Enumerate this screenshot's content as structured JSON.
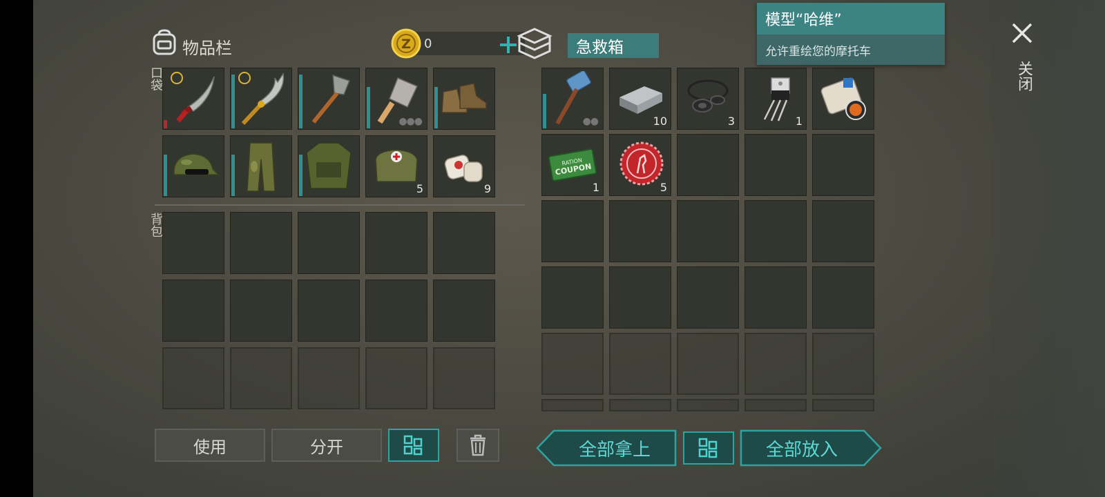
{
  "inventory": {
    "title": "物品栏",
    "coins": "0",
    "pocket_label": "口袋",
    "backpack_label": "背包",
    "pocket_items": [
      {
        "name": "machete-icon",
        "qty": ""
      },
      {
        "name": "serrated-blade-icon",
        "qty": ""
      },
      {
        "name": "shovel-icon",
        "qty": ""
      },
      {
        "name": "cleaver-icon",
        "qty": ""
      },
      {
        "name": "boots-icon",
        "qty": ""
      },
      {
        "name": "camo-cap-icon",
        "qty": ""
      },
      {
        "name": "camo-pants-icon",
        "qty": ""
      },
      {
        "name": "tactical-vest-icon",
        "qty": ""
      },
      {
        "name": "medkit-bag-icon",
        "qty": "5"
      },
      {
        "name": "bandage-icon",
        "qty": "9"
      }
    ]
  },
  "container": {
    "title": "急救箱",
    "items": [
      {
        "name": "sledgehammer-icon",
        "qty": ""
      },
      {
        "name": "iron-ingot-icon",
        "qty": "10"
      },
      {
        "name": "rubber-seals-icon",
        "qty": "3"
      },
      {
        "name": "transistor-icon",
        "qty": "1"
      },
      {
        "name": "magazine-icon",
        "qty": ""
      },
      {
        "name": "ration-coupon-icon",
        "qty": "1"
      },
      {
        "name": "bottle-cap-icon",
        "qty": "5"
      }
    ]
  },
  "tooltip": {
    "title": "模型“哈维”",
    "subtitle": "允许重绘您的摩托车"
  },
  "buttons": {
    "use": "使用",
    "split": "分开",
    "take_all": "全部拿上",
    "put_all": "全部放入",
    "close": "关闭"
  },
  "colors": {
    "accent": "#2fa3a0",
    "slot": "#33352f",
    "tooltip": "#3c8384"
  }
}
